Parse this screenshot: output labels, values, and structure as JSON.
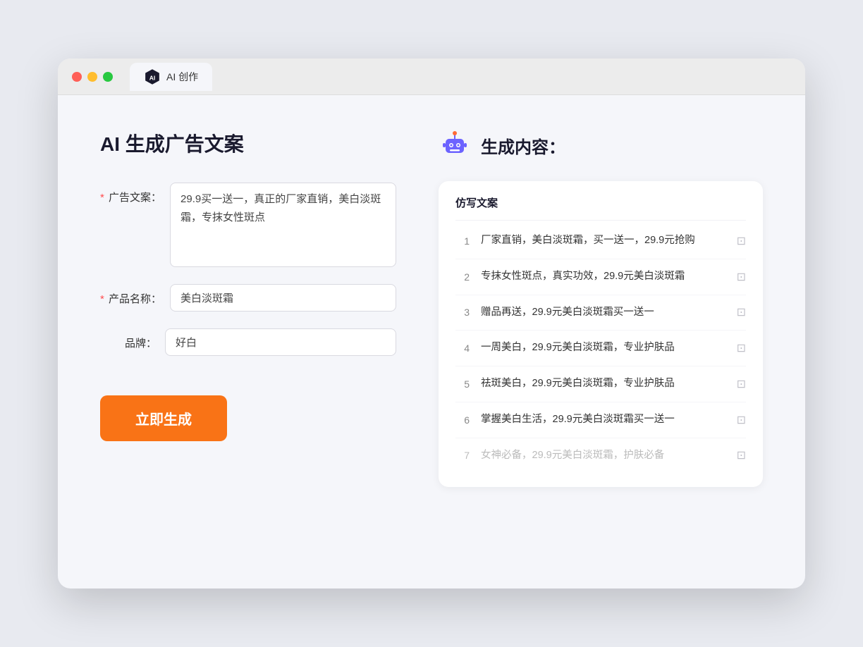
{
  "window": {
    "tab_label": "AI 创作"
  },
  "left": {
    "title": "AI 生成广告文案",
    "fields": [
      {
        "id": "ad-copy",
        "label": "广告文案：",
        "required": true,
        "type": "textarea",
        "value": "29.9买一送一，真正的厂家直销，美白淡斑霜，专抹女性斑点"
      },
      {
        "id": "product-name",
        "label": "产品名称：",
        "required": true,
        "type": "input",
        "value": "美白淡斑霜"
      },
      {
        "id": "brand",
        "label": "品牌：",
        "required": false,
        "type": "input",
        "value": "好白"
      }
    ],
    "button_label": "立即生成"
  },
  "right": {
    "title": "生成内容：",
    "table_header": "仿写文案",
    "results": [
      {
        "num": "1",
        "text": "厂家直销，美白淡斑霜，买一送一，29.9元抢购",
        "faded": false
      },
      {
        "num": "2",
        "text": "专抹女性斑点，真实功效，29.9元美白淡斑霜",
        "faded": false
      },
      {
        "num": "3",
        "text": "赠品再送，29.9元美白淡斑霜买一送一",
        "faded": false
      },
      {
        "num": "4",
        "text": "一周美白，29.9元美白淡斑霜，专业护肤品",
        "faded": false
      },
      {
        "num": "5",
        "text": "祛斑美白，29.9元美白淡斑霜，专业护肤品",
        "faded": false
      },
      {
        "num": "6",
        "text": "掌握美白生活，29.9元美白淡斑霜买一送一",
        "faded": false
      },
      {
        "num": "7",
        "text": "女神必备，29.9元美白淡斑霜，护肤必备",
        "faded": true
      }
    ]
  }
}
